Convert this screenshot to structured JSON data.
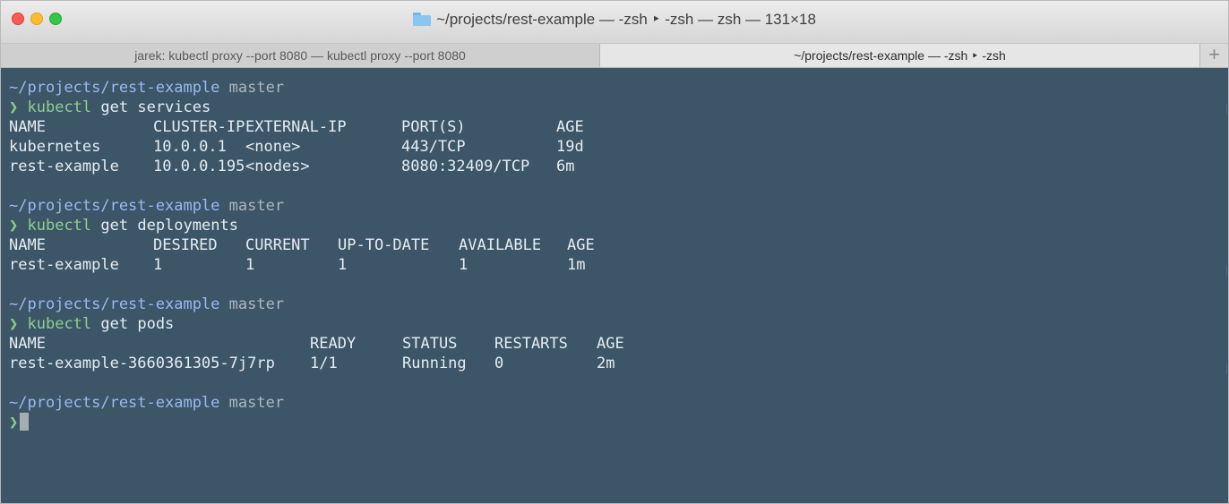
{
  "window": {
    "title": "~/projects/rest-example — -zsh ‣ -zsh — zsh — 131×18"
  },
  "tabs": [
    {
      "label": "jarek: kubectl proxy --port 8080 — kubectl proxy --port 8080",
      "active": false
    },
    {
      "label": "~/projects/rest-example — -zsh ‣ -zsh",
      "active": true
    }
  ],
  "new_tab_label": "+",
  "colors": {
    "terminal_bg": "#3c5668",
    "path": "#9ab8f2",
    "command": "#8ecf8e",
    "text": "#e6ecf1"
  },
  "blocks": [
    {
      "cwd": "~/projects/rest-example",
      "branch": "master",
      "prompt": "❯",
      "command": "kubectl",
      "args": "get services",
      "header": [
        "NAME",
        "CLUSTER-IP",
        "EXTERNAL-IP",
        "PORT(S)",
        "AGE"
      ],
      "rows": [
        [
          "kubernetes",
          "10.0.0.1",
          "<none>",
          "443/TCP",
          "19d"
        ],
        [
          "rest-example",
          "10.0.0.195",
          "<nodes>",
          "8080:32409/TCP",
          "6m"
        ]
      ]
    },
    {
      "cwd": "~/projects/rest-example",
      "branch": "master",
      "prompt": "❯",
      "command": "kubectl",
      "args": "get deployments",
      "header": [
        "NAME",
        "DESIRED",
        "CURRENT",
        "UP-TO-DATE",
        "AVAILABLE",
        "AGE"
      ],
      "rows": [
        [
          "rest-example",
          "1",
          "1",
          "1",
          "1",
          "1m"
        ]
      ]
    },
    {
      "cwd": "~/projects/rest-example",
      "branch": "master",
      "prompt": "❯",
      "command": "kubectl",
      "args": "get pods",
      "header": [
        "NAME",
        "READY",
        "STATUS",
        "RESTARTS",
        "AGE"
      ],
      "rows": [
        [
          "rest-example-3660361305-7j7rp",
          "1/1",
          "Running",
          "0",
          "2m"
        ]
      ]
    }
  ],
  "final_prompt": {
    "cwd": "~/projects/rest-example",
    "branch": "master",
    "prompt": "❯"
  }
}
